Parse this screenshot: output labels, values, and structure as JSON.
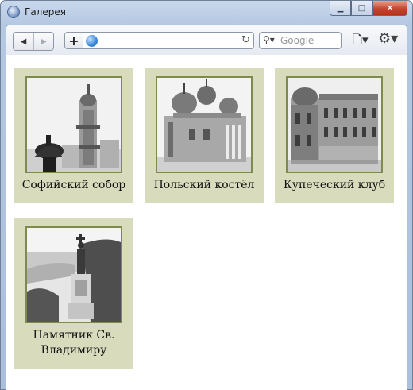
{
  "window": {
    "title": "Галерея"
  },
  "toolbar": {
    "back_icon": "back-arrow-icon",
    "forward_icon": "forward-arrow-icon",
    "add_icon": "plus-icon",
    "address": "",
    "search_placeholder": "Google"
  },
  "gallery": {
    "items": [
      {
        "caption": "Софийский собор"
      },
      {
        "caption": "Польский костёл"
      },
      {
        "caption": "Купеческий клуб"
      },
      {
        "caption": "Памятник Св. Владимиру"
      }
    ]
  }
}
